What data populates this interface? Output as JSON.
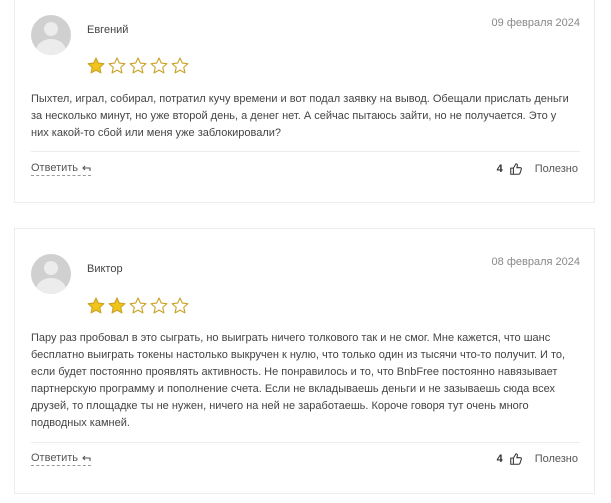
{
  "reviews": [
    {
      "author": "Евгений",
      "date": "09 февраля 2024",
      "rating": 1,
      "max_rating": 5,
      "text": "Пыхтел, играл, собирал, потратил кучу времени и вот подал заявку на вывод. Обещали прислать деньги за несколько минут, но уже второй день, а денег нет. А сейчас пытаюсь зайти, но не получается. Это у них какой-то сбой или меня уже заблокировали?",
      "reply_label": "Ответить",
      "likes": "4",
      "helpful_label": "Полезно"
    },
    {
      "author": "Виктор",
      "date": "08 февраля 2024",
      "rating": 2,
      "max_rating": 5,
      "text": "Пару раз пробовал в это сыграть, но выиграть ничего толкового так и не смог. Мне кажется, что шанс бесплатно выиграть токены настолько выкручен к нулю, что только один из тысячи что-то получит. И то, если будет постоянно проявлять активность. Не понравилось и то, что BnbFree постоянно навязывает партнерскую программу и пополнение счета. Если не вкладываешь деньги и не зазываешь сюда всех друзей, то площадке ты не нужен, ничего на ней не заработаешь. Короче говоря тут очень много подводных камней.",
      "reply_label": "Ответить",
      "likes": "4",
      "helpful_label": "Полезно"
    }
  ],
  "colors": {
    "star_filled": "#f0c419",
    "star_empty": "#c9a227"
  },
  "icons": {
    "star": "star-icon",
    "reply": "reply-arrow-icon",
    "like": "thumbs-up-icon"
  }
}
